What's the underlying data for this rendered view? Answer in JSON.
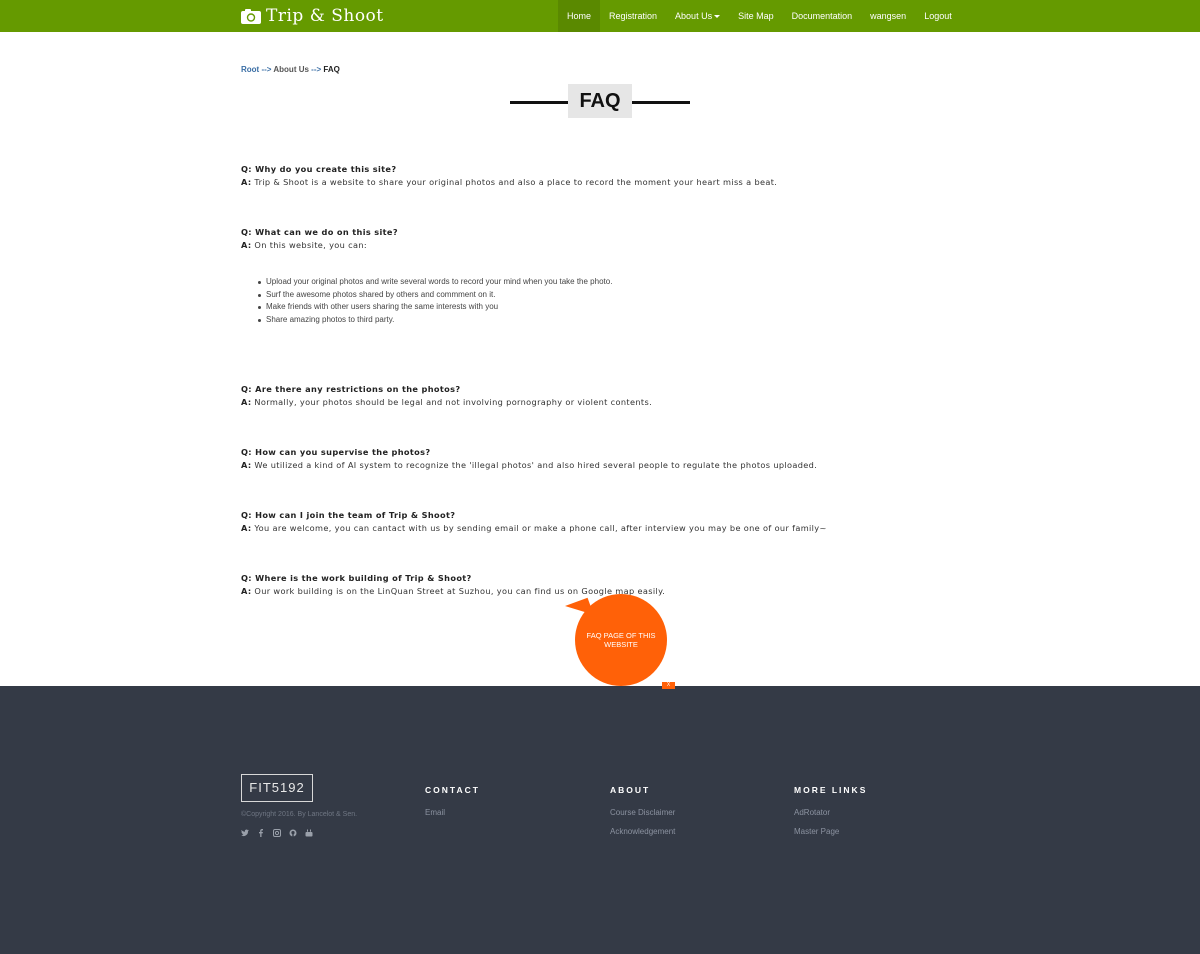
{
  "navbar": {
    "brand": "Trip & Shoot",
    "items": [
      {
        "label": "Home"
      },
      {
        "label": "Registration"
      },
      {
        "label": "About Us"
      },
      {
        "label": "Site Map"
      },
      {
        "label": "Documentation"
      },
      {
        "label": "wangsen"
      },
      {
        "label": "Logout"
      }
    ]
  },
  "breadcrumb": {
    "root": "Root",
    "sep1": " --> ",
    "about": "About Us",
    "sep2": " --> ",
    "current": "FAQ"
  },
  "page_title": "FAQ",
  "faq": [
    {
      "q": "Q: Why do you create this site?",
      "a_label": "A:",
      "a": " Trip & Shoot is a website to share your original photos and also a place to record the moment your heart miss a beat."
    },
    {
      "q": "Q: What can we do on this site?",
      "a_label": "A:",
      "a": " On this website, you can:"
    },
    {
      "q": "Q: Are there any restrictions on the photos?",
      "a_label": "A:",
      "a": " Normally, your photos should be legal and not involving pornography or violent contents."
    },
    {
      "q": "Q: How can you supervise the photos?",
      "a_label": "A:",
      "a": " We utilized a kind of AI system to recognize the 'illegal photos' and also hired several people to regulate the photos uploaded."
    },
    {
      "q": "Q: How can I join the team of Trip & Shoot?",
      "a_label": "A:",
      "a": " You are welcome, you can cantact with us by sending email or make a phone call, after interview you may be one of our family~"
    },
    {
      "q": "Q: Where is the work building of Trip & Shoot?",
      "a_label": "A:",
      "a": " Our work building is on the LinQuan Street at Suzhou, you can find us on Google map easily."
    }
  ],
  "bullets": [
    "Upload your original photos and write several words to record your mind when you take the photo.",
    "Surf the awesome photos shared by others and commment on it.",
    "Make friends with other users sharing the same interests with you",
    "Share amazing photos to third party."
  ],
  "bubble": {
    "text": "FAQ PAGE OF THIS WEBSITE",
    "close": "X"
  },
  "footer": {
    "logo": "FIT5192",
    "copyright": "©Copyright 2016. By Lancelot & Sen.",
    "contact": {
      "title": "CONTACT",
      "links": [
        "Email"
      ]
    },
    "about": {
      "title": "ABOUT",
      "links": [
        "Course Disclaimer",
        "Acknowledgement"
      ]
    },
    "more": {
      "title": "MORE LINKS",
      "links": [
        "AdRotator",
        "Master Page"
      ]
    },
    "socials": [
      "twitter-icon",
      "facebook-icon",
      "instagram-icon",
      "github-icon",
      "youtube-icon"
    ]
  },
  "colors": {
    "navbar": "#659a00",
    "footer": "#343a46",
    "accent": "#ff6108"
  }
}
